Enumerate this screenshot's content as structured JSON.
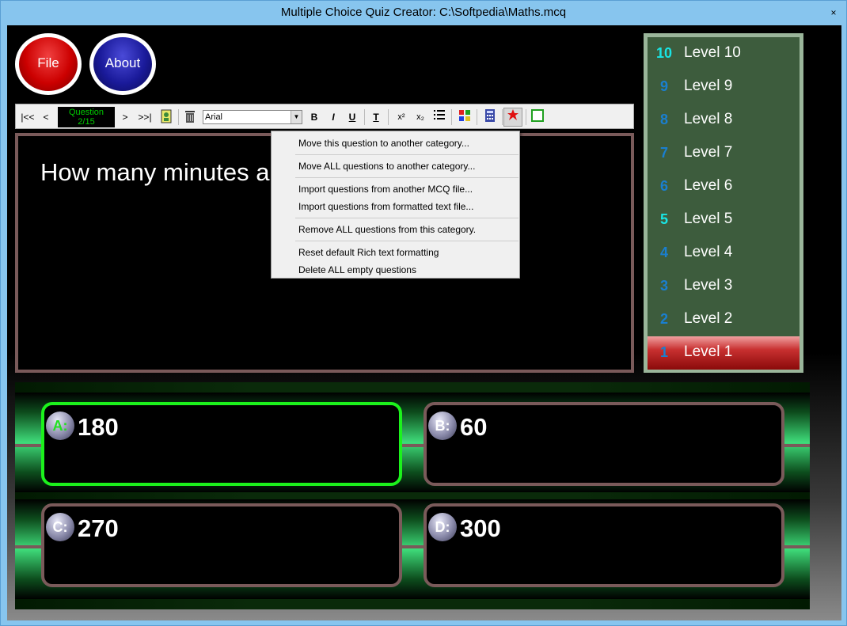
{
  "window": {
    "title": "Multiple Choice Quiz Creator: C:\\Softpedia\\Maths.mcq",
    "close_glyph": "×"
  },
  "buttons": {
    "file": "File",
    "about": "About"
  },
  "toolbar": {
    "first": "|<<",
    "prev": "<",
    "next": ">",
    "last": ">>|",
    "question_label": "Question",
    "question_counter": "2/15",
    "font": "Arial",
    "bold": "B",
    "italic": "I",
    "underline": "U",
    "text_style": "T",
    "superscript": "x²",
    "subscript": "x₂"
  },
  "question": {
    "text": "How many minutes a"
  },
  "context_menu": {
    "items": [
      "Move this question to another category...",
      "Move ALL questions to another category...",
      "Import questions from another MCQ file...",
      "Import questions from formatted text file...",
      "Remove ALL questions from this category.",
      "Reset default Rich text formatting",
      "Delete ALL empty questions"
    ]
  },
  "levels": [
    {
      "num": "10",
      "label": "Level 10",
      "num_color": "#19e5e5"
    },
    {
      "num": "9",
      "label": "Level 9",
      "num_color": "#1a7fd0"
    },
    {
      "num": "8",
      "label": "Level 8",
      "num_color": "#1a7fd0"
    },
    {
      "num": "7",
      "label": "Level 7",
      "num_color": "#1a7fd0"
    },
    {
      "num": "6",
      "label": "Level 6",
      "num_color": "#1a7fd0"
    },
    {
      "num": "5",
      "label": "Level 5",
      "num_color": "#19e5e5"
    },
    {
      "num": "4",
      "label": "Level 4",
      "num_color": "#1a7fd0"
    },
    {
      "num": "3",
      "label": "Level 3",
      "num_color": "#1a7fd0"
    },
    {
      "num": "2",
      "label": "Level 2",
      "num_color": "#1a7fd0"
    },
    {
      "num": "1",
      "label": "Level 1",
      "num_color": "#1a7fd0",
      "active": true
    }
  ],
  "answers": [
    {
      "letter": "A:",
      "value": "180",
      "selected": true
    },
    {
      "letter": "B:",
      "value": "60",
      "selected": false
    },
    {
      "letter": "C:",
      "value": "270",
      "selected": false
    },
    {
      "letter": "D:",
      "value": "300",
      "selected": false
    }
  ],
  "colors": {
    "accent_green": "#1cf21c",
    "level_panel": "#3d5c3d",
    "active_level": "#a01010",
    "frame": "#7a5a5a"
  }
}
